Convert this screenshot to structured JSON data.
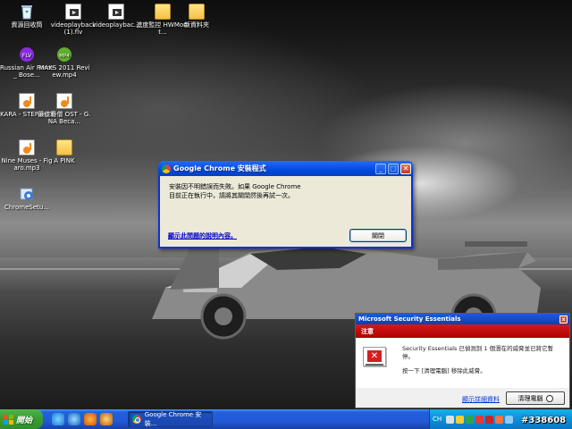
{
  "desktop": {
    "icons": [
      {
        "label": "資源回收筒",
        "icon": "recycle-bin-icon"
      },
      {
        "label": "videoplayback (1).flv",
        "icon": "video-file-icon"
      },
      {
        "label": "videoplaybac...",
        "icon": "video-file-icon"
      },
      {
        "label": "進度監控 HWMonit...",
        "icon": "folder-icon"
      },
      {
        "label": "新資料夾",
        "icon": "folder-icon"
      },
      {
        "label": "Russian Air Force _ Bose...",
        "icon": "flv-file-icon"
      },
      {
        "label": "MAKS 2011 Review.mp4",
        "icon": "mp4-file-icon"
      },
      {
        "label": "KARA - STEP.mp3",
        "icon": "audio-file-icon"
      },
      {
        "label": "最佳番僧 OST - G.NA Beca...",
        "icon": "audio-file-icon"
      },
      {
        "label": "Nine Muses - Figaro.mp3",
        "icon": "audio-file-icon"
      },
      {
        "label": "A PINK",
        "icon": "folder-icon"
      },
      {
        "label": "ChromeSetu...",
        "icon": "installer-icon"
      }
    ]
  },
  "chrome_dialog": {
    "title": "Google Chrome 安裝程式",
    "message_line1": "安裝因不明錯誤而失敗。如果 Google Chrome",
    "message_line2": "目前正在執行中，請將其關閉然後再試一次。",
    "help_link": "顯示此問題的說明內容。",
    "close_button": "關閉",
    "minimize_symbol": "_",
    "maximize_symbol": "□",
    "close_symbol": "✕"
  },
  "mse_alert": {
    "title": "Microsoft Security Essentials",
    "heading": "注意",
    "message": "Security Essentials 已偵測到 1 個潛在的威脅並已將它暫停。",
    "instruction": "按一下 [清理電腦] 移除此威脅。",
    "details_link": "顯示詳細資料",
    "clean_button": "清理電腦",
    "close_symbol": "x"
  },
  "taskbar": {
    "start_label": "開始",
    "active_task": "Google Chrome 安裝...",
    "input_language": "CH",
    "watermark": "#338608"
  },
  "colors": {
    "xp_blue": "#0a56e8",
    "mse_red": "#c80000",
    "link_blue": "#0000cc"
  }
}
